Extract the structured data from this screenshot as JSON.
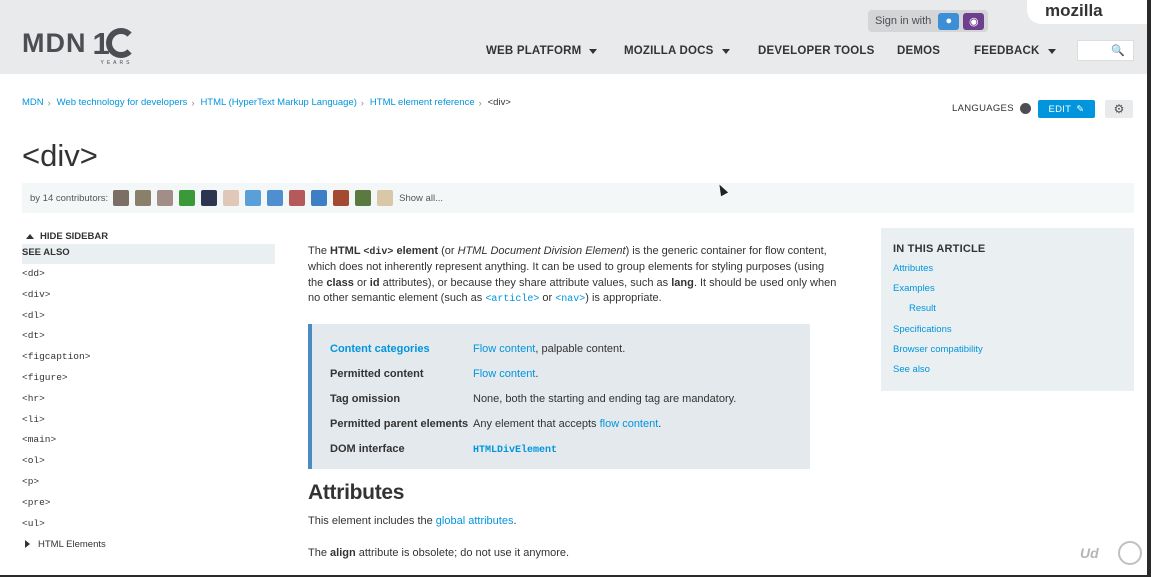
{
  "header": {
    "logo_text": "MDN",
    "logo_ten": "1",
    "logo_years": "YEARS",
    "signin_label": "Sign in with",
    "mozilla_label": "mozilla",
    "nav": [
      {
        "label": "WEB PLATFORM",
        "caret": true
      },
      {
        "label": "MOZILLA DOCS",
        "caret": true
      },
      {
        "label": "DEVELOPER TOOLS",
        "caret": false
      },
      {
        "label": "DEMOS",
        "caret": false
      },
      {
        "label": "FEEDBACK",
        "caret": true
      }
    ]
  },
  "breadcrumbs": {
    "items": [
      "MDN",
      "Web technology for developers",
      "HTML (HyperText Markup Language)",
      "HTML element reference"
    ],
    "current": "<div>"
  },
  "toolbar": {
    "languages_label": "LANGUAGES",
    "edit_label": "EDIT"
  },
  "page_title": "<div>",
  "contributors": {
    "label": "by 14 contributors:",
    "show_all": "Show all...",
    "avatar_colors": [
      "#7b6f65",
      "#8a7f68",
      "#a38d88",
      "#3a9a3a",
      "#2e3550",
      "#e0c8b8",
      "#5aa0d8",
      "#4f8fd0",
      "#b55a5a",
      "#3d7ec4",
      "#a44a30",
      "#5a7a40",
      "#d8c8a8"
    ]
  },
  "sidebar": {
    "hide_label": "HIDE SIDEBAR",
    "see_also": "SEE ALSO",
    "items": [
      "<dd>",
      "<div>",
      "<dl>",
      "<dt>",
      "<figcaption>",
      "<figure>",
      "<hr>",
      "<li>",
      "<main>",
      "<ol>",
      "<p>",
      "<pre>",
      "<ul>"
    ],
    "html_elements": "HTML Elements"
  },
  "intro": {
    "t1": "The ",
    "b1": "HTML ",
    "c1": "<div>",
    "b2": " element",
    "t2": " (or ",
    "i1": "HTML Document Division Element",
    "t3": ") is the generic container for flow content, which does not inherently represent anything. It can be used to group elements for styling purposes (using the ",
    "b3": "class",
    "t4": " or ",
    "b4": "id",
    "t5": " attributes), or because they share attribute values, such as ",
    "b5": "lang",
    "t6": ". It should be used only when no other semantic element (such as ",
    "c2": "<article>",
    "t7": " or ",
    "c3": "<nav>",
    "t8": ") is appropriate."
  },
  "properties": [
    {
      "key": "Content categories",
      "key_link": true,
      "value_link": "Flow content",
      "value_rest": ", palpable content."
    },
    {
      "key": "Permitted content",
      "key_link": false,
      "value_link": "Flow content",
      "value_rest": "."
    },
    {
      "key": "Tag omission",
      "key_link": false,
      "value_link": "",
      "value_rest": "None, both the starting and ending tag are mandatory."
    },
    {
      "key": "Permitted parent elements",
      "key_link": false,
      "value_prefix": "Any element that accepts ",
      "value_link": "flow content",
      "value_rest": "."
    },
    {
      "key": "DOM interface",
      "key_link": false,
      "value_code": "HTMLDivElement"
    }
  ],
  "attributes": {
    "heading": "Attributes",
    "p1_prefix": "This element includes the ",
    "p1_link": "global attributes",
    "p1_suffix": ".",
    "p2_prefix": "The ",
    "p2_bold": "align",
    "p2_suffix": " attribute is obsolete; do not use it anymore."
  },
  "toc": {
    "heading": "IN THIS ARTICLE",
    "items": [
      {
        "label": "Attributes",
        "sub": false
      },
      {
        "label": "Examples",
        "sub": false
      },
      {
        "label": "Result",
        "sub": true
      },
      {
        "label": "Specifications",
        "sub": false
      },
      {
        "label": "Browser compatibility",
        "sub": false
      },
      {
        "label": "See also",
        "sub": false
      }
    ]
  },
  "watermark": "Udemy"
}
